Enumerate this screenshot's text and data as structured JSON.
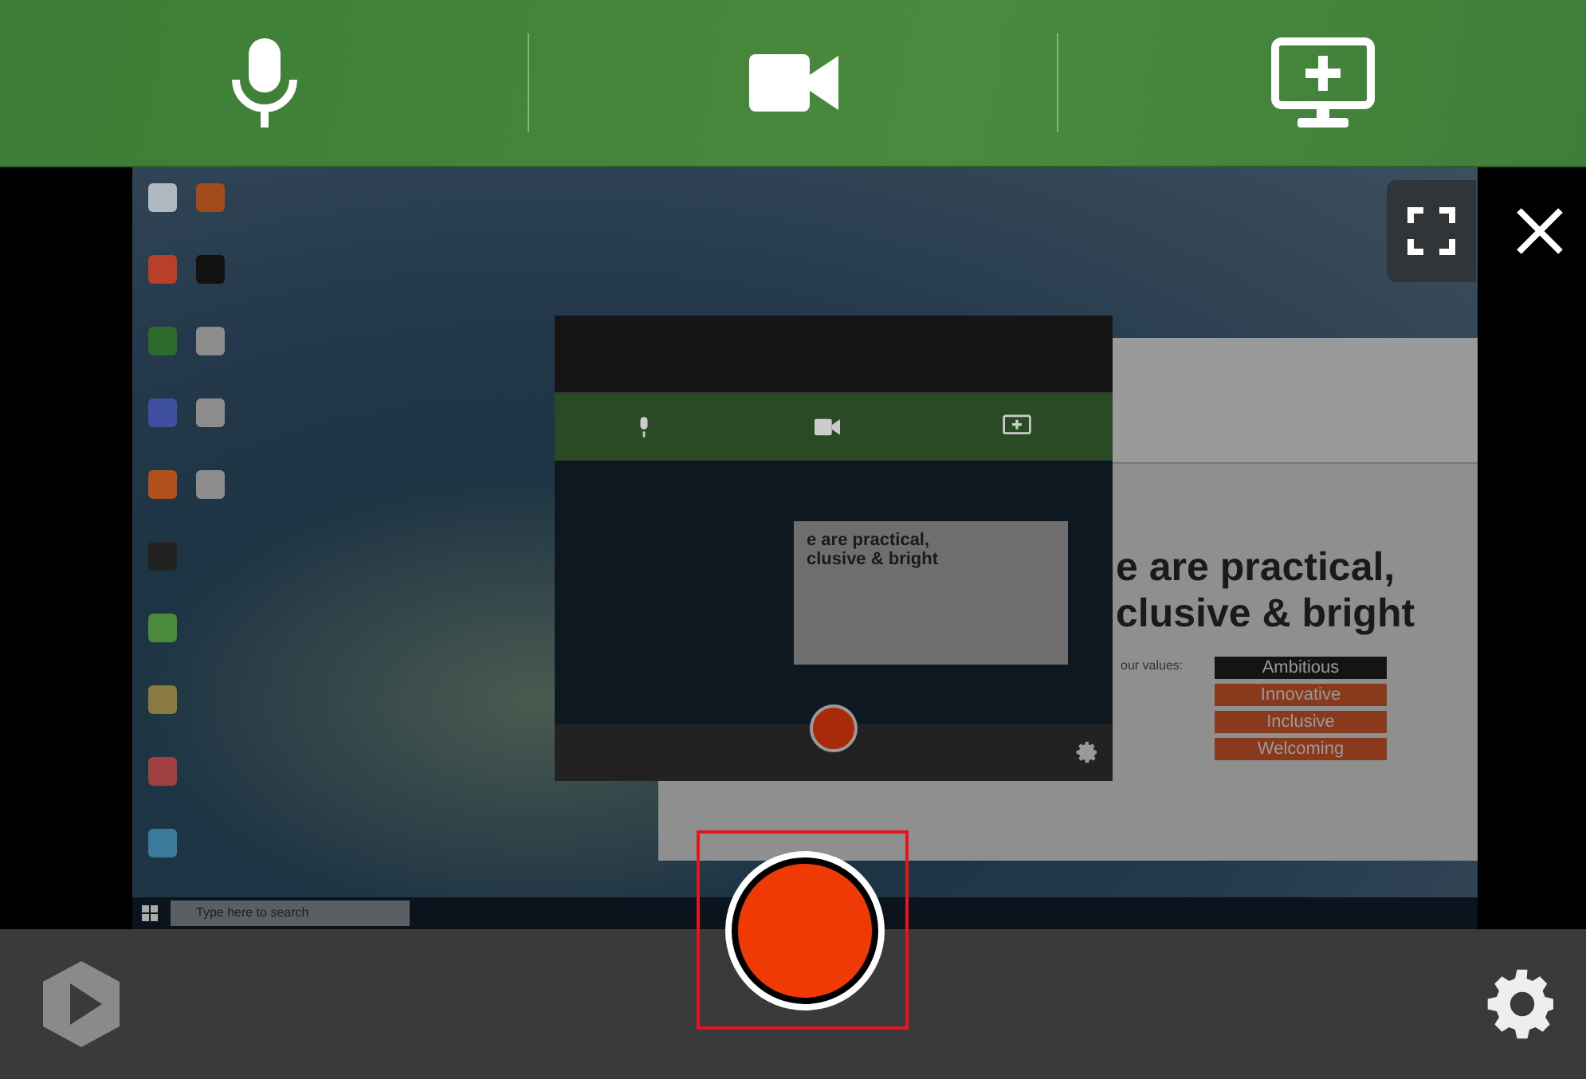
{
  "toolbar": {
    "sources": [
      {
        "kind": "microphone"
      },
      {
        "kind": "camera"
      },
      {
        "kind": "screen"
      }
    ]
  },
  "preview": {
    "slide": {
      "title_lines": [
        "e are practical,",
        "clusive & bright"
      ],
      "caption": "our values:",
      "values": [
        {
          "label": "Ambitious",
          "color": "#141414"
        },
        {
          "label": "Innovative",
          "color": "#8a3a1c"
        },
        {
          "label": "Inclusive",
          "color": "#8a3a1c"
        },
        {
          "label": "Welcoming",
          "color": "#8a3a1c"
        }
      ]
    },
    "nested_slide_lines": [
      "e are practical,",
      "clusive & bright"
    ],
    "taskbar": {
      "search_placeholder": "Type here to search"
    }
  }
}
